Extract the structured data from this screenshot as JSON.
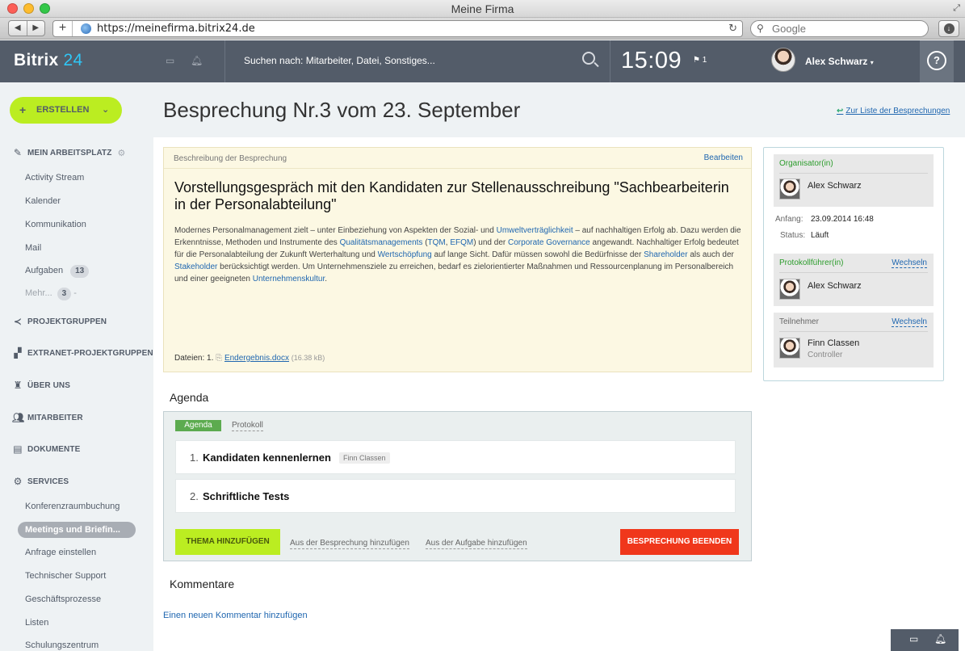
{
  "window": {
    "title": "Meine Firma"
  },
  "browser": {
    "url": "https://meinefirma.bitrix24.de",
    "search_placeholder": "Google"
  },
  "header": {
    "logo_name": "Bitrix",
    "logo_num": "24",
    "search_text": "Suchen nach: Mitarbeiter, Datei, Sonstiges...",
    "time": "15:09",
    "flag_count": "1",
    "user_name": "Alex Schwarz",
    "help_label": "?"
  },
  "sidebar": {
    "create_label": "ERSTELLEN",
    "workspace_label": "MEIN ARBEITSPLATZ",
    "workspace_items": [
      "Activity Stream",
      "Kalender",
      "Kommunikation",
      "Mail"
    ],
    "tasks_label": "Aufgaben",
    "tasks_count": "13",
    "more_label": "Mehr...",
    "more_count": "3",
    "more_dash": "-",
    "sections": [
      "PROJEKTGRUPPEN",
      "EXTRANET-PROJEKTGRUPPEN",
      "ÜBER UNS",
      "MITARBEITER",
      "DOKUMENTE",
      "SERVICES"
    ],
    "services_items": {
      "conf": "Konferenzraumbuchung",
      "active": "Meetings und Briefin...",
      "request": "Anfrage einstellen",
      "support": "Technischer Support",
      "processes": "Geschäftsprozesse",
      "lists": "Listen",
      "training": "Schulungszentrum"
    }
  },
  "page": {
    "title": "Besprechung Nr.3 vom 23. September",
    "back_link": "Zur Liste der Besprechungen"
  },
  "description": {
    "header_label": "Beschreibung der Besprechung",
    "edit_label": "Bearbeiten",
    "title": "Vorstellungsgespräch mit den Kandidaten zur Stellenausschreibung \"Sachbearbeiterin in der Personalabteilung\"",
    "text": {
      "p1": "Modernes Personalmanagement zielt – unter Einbeziehung von Aspekten der Sozial- und ",
      "l1": "Umweltverträglichkeit",
      "p2": " – auf nachhaltigen Erfolg ab. Dazu werden die Erkenntnisse, Methoden und Instrumente des ",
      "l2": "Qualitätsmanagements",
      "p3": " (",
      "l3": "TQM",
      "p4": ", ",
      "l4": "EFQM",
      "p5": ") und der ",
      "l5": "Corporate Governance",
      "p6": " angewandt. Nachhaltiger Erfolg bedeutet für die Personalabteilung der Zukunft Werterhaltung und ",
      "l6": "Wertschöpfung",
      "p7": " auf lange Sicht. Dafür müssen sowohl die Bedürfnisse der ",
      "l7": "Shareholder",
      "p8": " als auch der ",
      "l8": "Stakeholder",
      "p9": " berücksichtigt werden. Um Unternehmensziele zu erreichen, bedarf es zielorientierter Maßnahmen und Ressourcenplanung im Personalbereich und einer geeigneten ",
      "l9": "Unternehmenskultur",
      "p10": "."
    },
    "files_label": "Dateien:",
    "file_index": "1.",
    "file_name": "Endergebnis.docx",
    "file_size": "(16.38 kB)"
  },
  "meeting_info": {
    "organizer_label": "Organisator(in)",
    "organizer_name": "Alex Schwarz",
    "start_label": "Anfang:",
    "start_value": "23.09.2014 16:48",
    "status_label": "Status:",
    "status_value": "Läuft",
    "protocol_label": "Protokollführer(in)",
    "change_label": "Wechseln",
    "protocol_name": "Alex Schwarz",
    "participants_label": "Teilnehmer",
    "participant_name": "Finn Classen",
    "participant_role": "Controller"
  },
  "agenda": {
    "section_title": "Agenda",
    "tab_agenda": "Agenda",
    "tab_protocol": "Protokoll",
    "items": [
      {
        "num": "1.",
        "title": "Kandidaten kennenlernen",
        "tag": "Finn Classen"
      },
      {
        "num": "2.",
        "title": "Schriftliche Tests",
        "tag": ""
      }
    ],
    "add_topic": "THEMA HINZUFÜGEN",
    "from_meeting": "Aus der Besprechung hinzufügen",
    "from_task": "Aus der Aufgabe hinzufügen",
    "end_meeting": "BESPRECHUNG BEENDEN"
  },
  "comments": {
    "section_title": "Kommentare",
    "add_comment": "Einen neuen Kommentar hinzufügen"
  }
}
